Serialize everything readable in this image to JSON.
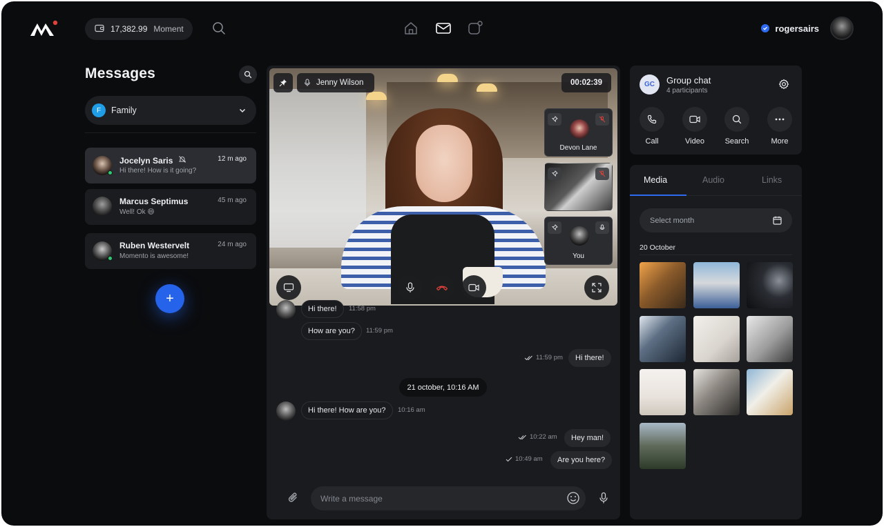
{
  "header": {
    "wallet_amount": "17,382.99",
    "wallet_currency": "Moment",
    "username": "rogersairs"
  },
  "sidebar": {
    "title": "Messages",
    "filter": {
      "badge": "F",
      "label": "Family"
    },
    "conversations": [
      {
        "name": "Jocelyn Saris",
        "preview": "Hi there! How is it going?",
        "time": "12 m ago",
        "muted": true,
        "online": true
      },
      {
        "name": "Marcus Septimus",
        "preview": "Well! Ok 😄",
        "time": "45 m ago",
        "muted": false,
        "online": false
      },
      {
        "name": "Ruben Westervelt",
        "preview": "Momento is awesome!",
        "time": "24 m ago",
        "muted": false,
        "online": true
      }
    ],
    "fab_label": "+"
  },
  "call": {
    "speaker": "Jenny Wilson",
    "duration": "00:02:39",
    "participants": [
      {
        "name": "Devon Lane"
      },
      {
        "name": ""
      },
      {
        "name": "You"
      }
    ]
  },
  "chat": {
    "messages": [
      {
        "text": "Hi there!",
        "time": "11:58 pm",
        "direction": "in"
      },
      {
        "text": "How are you?",
        "time": "11:59 pm",
        "direction": "in"
      },
      {
        "text": "Hi there!",
        "time": "11:59 pm",
        "direction": "out"
      },
      {
        "text": "Hi there! How are you?",
        "time": "10:16 am",
        "direction": "in"
      },
      {
        "text": "Hey man!",
        "time": "10:22 am",
        "direction": "out"
      },
      {
        "text": "Are you here?",
        "time": "10:49 am",
        "direction": "out"
      }
    ],
    "date_divider": "21 october, 10:16 AM",
    "composer_placeholder": "Write a message"
  },
  "group": {
    "badge": "GC",
    "title": "Group chat",
    "subtitle": "4 participants",
    "actions": [
      "Call",
      "Video",
      "Search",
      "More"
    ]
  },
  "media": {
    "tabs": [
      "Media",
      "Audio",
      "Links"
    ],
    "active_tab": "Media",
    "select_placeholder": "Select month",
    "date_label": "20 October",
    "thumbnails": [
      "cafe-meeting",
      "man-sitting",
      "man-night-city",
      "glass-skyscraper",
      "white-interior",
      "woman-laptop",
      "white-landscape",
      "office-desk",
      "coffee-mugs",
      "woman-portrait"
    ]
  },
  "colors": {
    "accent": "#2563eb",
    "background": "#0b0c0e",
    "panel": "#1a1b1e",
    "online": "#2ecc71",
    "end_call": "#e0423b"
  }
}
